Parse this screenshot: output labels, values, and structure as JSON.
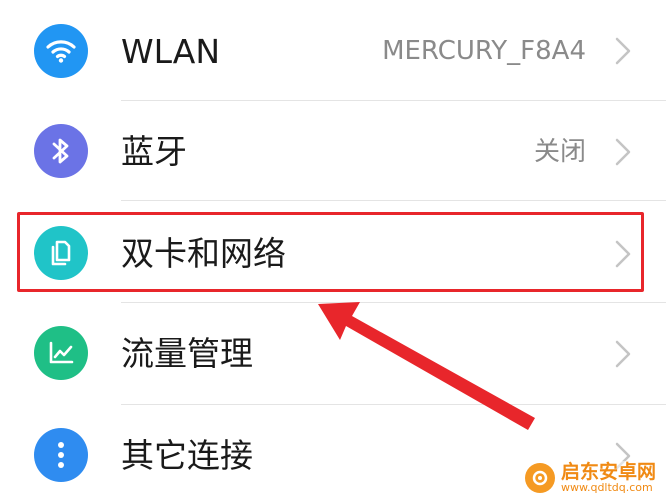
{
  "settings": {
    "items": [
      {
        "icon": "wifi-icon",
        "label": "WLAN",
        "value": "MERCURY_F8A4",
        "icon_color": "#2196f3"
      },
      {
        "icon": "bluetooth-icon",
        "label": "蓝牙",
        "value": "关闭",
        "icon_color": "#6b73e6"
      },
      {
        "icon": "dual-sim-icon",
        "label": "双卡和网络",
        "value": "",
        "icon_color": "#20c4c8",
        "highlighted": true
      },
      {
        "icon": "data-usage-icon",
        "label": "流量管理",
        "value": "",
        "icon_color": "#1fbf86"
      },
      {
        "icon": "more-connections-icon",
        "label": "其它连接",
        "value": "",
        "icon_color": "#2f8cf0"
      }
    ]
  },
  "annotation": {
    "highlight_color": "#e8262b",
    "arrow_color": "#e8262b"
  },
  "watermark": {
    "title": "启东安卓网",
    "url": "www.qdltdq.com",
    "color": "#f08a14"
  }
}
